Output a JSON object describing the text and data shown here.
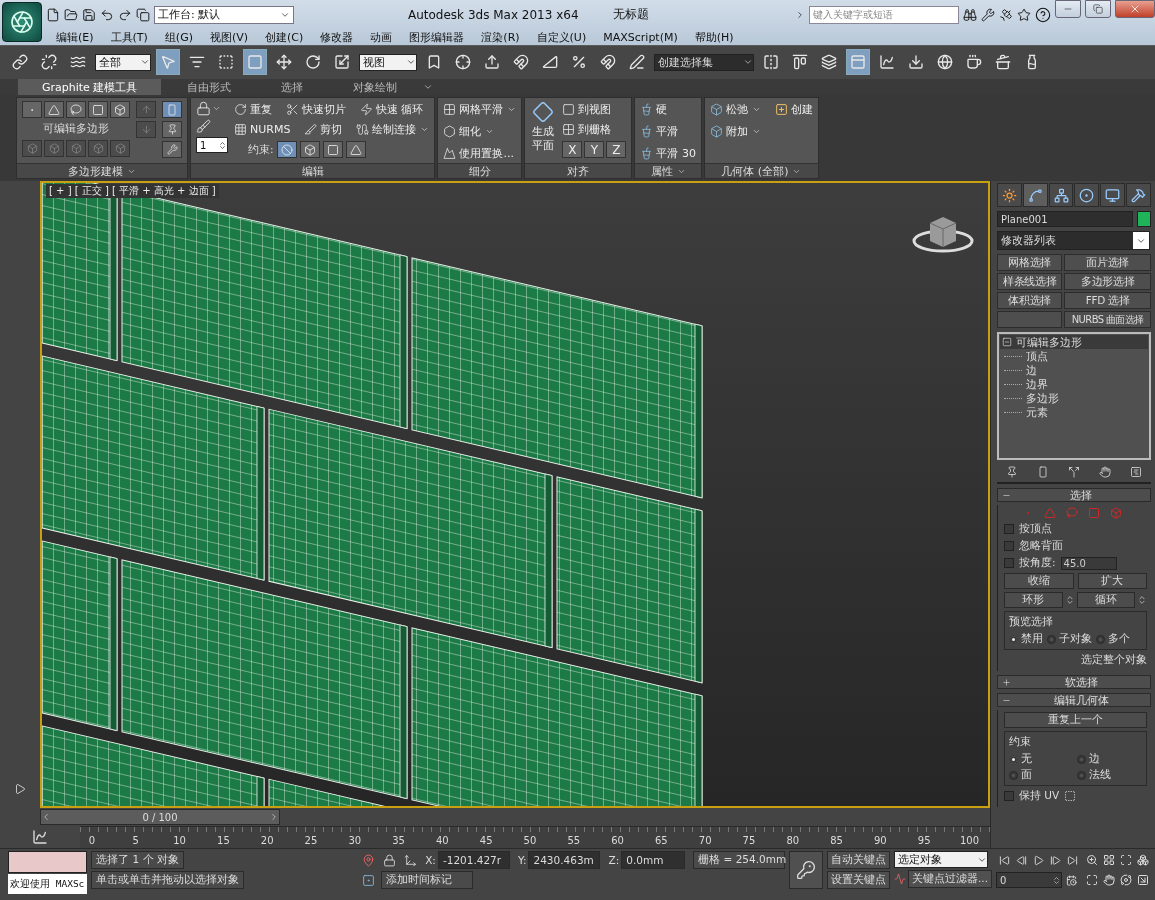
{
  "window": {
    "title": "Autodesk 3ds Max  2013 x64",
    "document": "无标题",
    "workspace": "工作台: 默认",
    "search_placeholder": "键入关键字或短语"
  },
  "menu": [
    "编辑(E)",
    "工具(T)",
    "组(G)",
    "视图(V)",
    "创建(C)",
    "修改器",
    "动画",
    "图形编辑器",
    "渲染(R)",
    "自定义(U)",
    "MAXScript(M)",
    "帮助(H)"
  ],
  "toolbar": {
    "selection_filter": "全部",
    "coordinate_system": "视图",
    "named_selection": "创建选择集"
  },
  "ribbon": {
    "tabs": [
      {
        "label": "Graphite 建模工具",
        "selected": true
      },
      {
        "label": "自由形式",
        "selected": false
      },
      {
        "label": "选择",
        "selected": false
      },
      {
        "label": "对象绘制",
        "selected": false
      }
    ],
    "panels": [
      {
        "kind": "polygon_modeling",
        "title": "多边形建模",
        "menu": true,
        "label": "可编辑多边形"
      },
      {
        "kind": "edit",
        "title": "编辑",
        "menu": false,
        "spinner": "1",
        "tools": [
          {
            "label": "重复",
            "menu": false
          },
          {
            "label": "快速切片",
            "menu": false
          },
          {
            "label": "快速 循环",
            "menu": false
          },
          {
            "label": "NURMS",
            "menu": false
          },
          {
            "label": "剪切",
            "menu": false
          },
          {
            "label": "绘制连接",
            "menu": true
          }
        ],
        "constraint_label": "约束:",
        "constraints": [
          {
            "selected": true
          },
          {
            "selected": false
          },
          {
            "selected": false
          },
          {
            "selected": false
          }
        ]
      },
      {
        "kind": "subdivision",
        "title": "细分",
        "menu": false,
        "tools": [
          {
            "label": "网格平滑",
            "menu": true
          },
          {
            "label": "细化",
            "menu": true
          },
          {
            "label": "使用置换...",
            "menu": false
          }
        ]
      },
      {
        "kind": "align",
        "title": "对齐",
        "menu": false,
        "big": "生成平面",
        "tools": [
          {
            "label": "到视图",
            "menu": false
          },
          {
            "label": "到栅格",
            "menu": false
          }
        ],
        "axes": [
          "X",
          "Y",
          "Z"
        ]
      },
      {
        "kind": "properties",
        "title": "属性",
        "menu": true,
        "tools": [
          {
            "label": "硬",
            "menu": false
          },
          {
            "label": "平滑",
            "menu": false
          },
          {
            "label": "平滑 30",
            "menu": false
          }
        ]
      },
      {
        "kind": "geometry",
        "title": "几何体 (全部)",
        "menu": true,
        "tools": [
          {
            "label": "松弛",
            "menu": true
          },
          {
            "label": "创建",
            "menu": false
          },
          {
            "label": "附加",
            "menu": true
          }
        ]
      }
    ]
  },
  "viewport": {
    "label": "[ + ] [ 正交 ] [ 平滑 + 高光 + 边面 ]",
    "active": true
  },
  "command_panel": {
    "tabs": [
      {
        "selected": false
      },
      {
        "selected": true
      },
      {
        "selected": false
      },
      {
        "selected": false
      },
      {
        "selected": false
      },
      {
        "selected": false
      }
    ],
    "object_name": "Plane001",
    "color": "#1fb35a",
    "modifier_list": "修改器列表",
    "modifier_buttons": [
      {
        "kind": "text",
        "label": "网格选择"
      },
      {
        "kind": "text",
        "label": "面片选择"
      },
      {
        "kind": "text",
        "label": "样条线选择"
      },
      {
        "kind": "text",
        "label": "多边形选择"
      },
      {
        "kind": "text",
        "label": "体积选择"
      },
      {
        "kind": "text",
        "label": "FFD 选择"
      },
      {
        "kind": "blank"
      },
      {
        "kind": "text",
        "label": "NURBS 曲面选择"
      }
    ],
    "stack": [
      {
        "label": "可编辑多边形",
        "expanded": true,
        "selected": true,
        "children": [
          {
            "label": "顶点",
            "selected": false
          },
          {
            "label": "边",
            "selected": false
          },
          {
            "label": "边界",
            "selected": false
          },
          {
            "label": "多边形",
            "selected": false
          },
          {
            "label": "元素",
            "selected": false
          }
        ]
      }
    ],
    "rollouts": [
      {
        "kind": "selection",
        "title": "选择",
        "expanded": true,
        "options": [
          {
            "label": "按顶点",
            "checked": false
          },
          {
            "label": "忽略背面",
            "checked": false
          },
          {
            "label": "按角度:",
            "checked": false,
            "value": "45.0"
          }
        ],
        "buttons": [
          {
            "label": "收缩",
            "kind": "plain"
          },
          {
            "label": "扩大",
            "kind": "plain"
          },
          {
            "label": "环形",
            "kind": "spin"
          },
          {
            "label": "循环",
            "kind": "spin"
          }
        ],
        "preview": {
          "title": "预览选择",
          "options": [
            {
              "label": "禁用",
              "selected": true
            },
            {
              "label": "子对象",
              "selected": false
            },
            {
              "label": "多个",
              "selected": false
            }
          ]
        },
        "note": "选定整个对象"
      },
      {
        "kind": "soft",
        "title": "软选择",
        "expanded": false
      },
      {
        "kind": "edit_geometry",
        "title": "编辑几何体",
        "expanded": true,
        "button": "重复上一个",
        "constraints": {
          "title": "约束",
          "options": [
            {
              "label": "无",
              "selected": true
            },
            {
              "label": "边",
              "selected": false
            },
            {
              "label": "面",
              "selected": false
            },
            {
              "label": "法线",
              "selected": false
            }
          ]
        },
        "preserve_uv": {
          "label": "保持 UV",
          "checked": false
        }
      }
    ]
  },
  "timeline": {
    "position": "0 / 100",
    "level": 0,
    "ticks": [
      "0",
      "5",
      "10",
      "15",
      "20",
      "25",
      "30",
      "35",
      "40",
      "45",
      "50",
      "55",
      "60",
      "65",
      "70",
      "75",
      "80",
      "85",
      "90",
      "95",
      "100"
    ]
  },
  "status": {
    "listener": "欢迎使用 MAXSc",
    "selection_info": "选择了 1 个 对象",
    "prompt": "单击或单击并拖动以选择对象",
    "coords": [
      {
        "axis": "X:",
        "value": "-1201.427r"
      },
      {
        "axis": "Y:",
        "value": "2430.463m"
      },
      {
        "axis": "Z:",
        "value": "0.0mm"
      }
    ],
    "grid": "栅格 = 254.0mm",
    "add_time_tag": "添加时间标记",
    "auto_key": "自动关键点",
    "set_key": "设置关键点",
    "key_mode": "选定对象",
    "key_filters": "关键点过滤器...",
    "frame": "0"
  }
}
